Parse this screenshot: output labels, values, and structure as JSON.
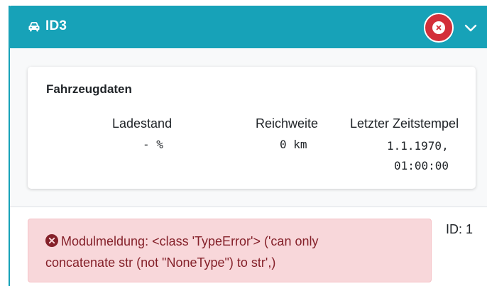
{
  "header": {
    "title": "ID3",
    "vehicle_icon": "car-icon",
    "status_icon": "error-circle-icon",
    "toggle_icon": "chevron-down-icon",
    "accent_color": "#17a2b8",
    "status_color": "#d32f3a"
  },
  "vehicle_data": {
    "title": "Fahrzeugdaten",
    "columns": [
      {
        "label": "Ladestand",
        "value": "- %"
      },
      {
        "label": "Reichweite",
        "value": "0 km"
      },
      {
        "label": "Letzter Zeitstempel",
        "value_line1": "1.1.1970,",
        "value_line2": "01:00:00"
      }
    ]
  },
  "footer": {
    "alert_icon": "error-circle-icon",
    "alert_text_line1": "Modulmeldung: <class 'TypeError'> ('can only",
    "alert_text_line2": "concatenate str (not \"NoneType\") to str',)",
    "alert_color": "#842029",
    "id_text": "ID: 1"
  }
}
